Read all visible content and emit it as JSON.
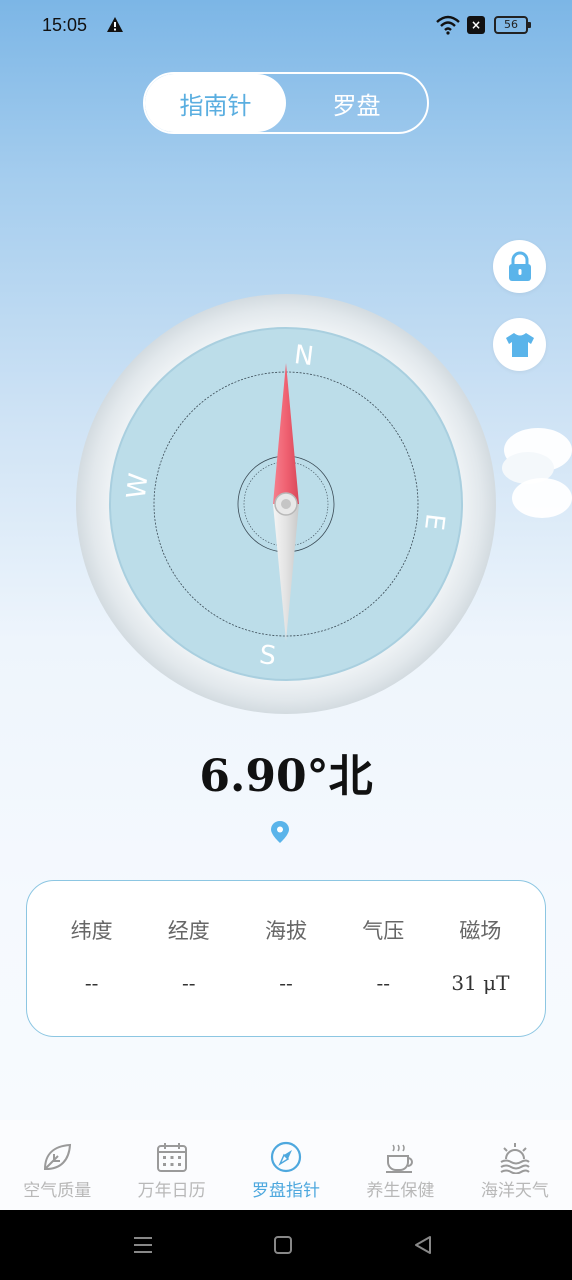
{
  "status_bar": {
    "time": "15:05",
    "battery": "56",
    "icons": [
      "warning-icon",
      "wifi-icon",
      "no-sim-icon",
      "battery-icon"
    ]
  },
  "tabs": [
    {
      "label": "指南针",
      "active": true
    },
    {
      "label": "罗盘",
      "active": false
    }
  ],
  "side_buttons": [
    "lock-icon",
    "tshirt-icon"
  ],
  "compass": {
    "heading_degrees": 6.9,
    "north": "N",
    "south": "S",
    "east": "E",
    "west": "W"
  },
  "heading_text": "6.90°北",
  "info": {
    "items": [
      {
        "label": "纬度",
        "value": "--"
      },
      {
        "label": "经度",
        "value": "--"
      },
      {
        "label": "海拔",
        "value": "--"
      },
      {
        "label": "气压",
        "value": "--"
      },
      {
        "label": "磁场",
        "value": "31 μT"
      }
    ]
  },
  "bottom_nav": [
    {
      "label": "空气质量",
      "icon": "leaf-icon",
      "active": false
    },
    {
      "label": "万年日历",
      "icon": "calendar-icon",
      "active": false
    },
    {
      "label": "罗盘指针",
      "icon": "compass-icon",
      "active": true
    },
    {
      "label": "养生保健",
      "icon": "tea-cup-icon",
      "active": false
    },
    {
      "label": "海洋天气",
      "icon": "sunrise-sea-icon",
      "active": false
    }
  ],
  "colors": {
    "accent": "#4ea8de",
    "needle_north": "#f06b7a",
    "needle_south": "#e6e6e6",
    "dial": "#b9dbe8"
  }
}
